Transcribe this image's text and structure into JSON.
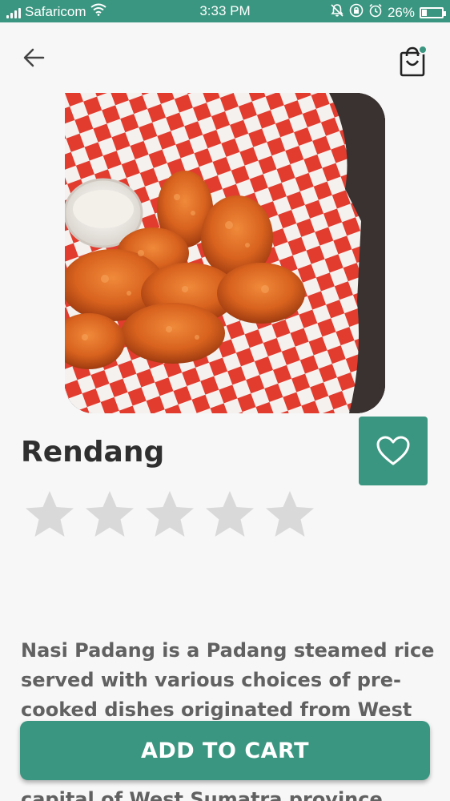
{
  "status_bar": {
    "carrier": "Safaricom",
    "time": "3:33 PM",
    "battery": "26%",
    "battery_level": 0.26,
    "icons": [
      "signal-icon",
      "wifi-icon",
      "mute-icon",
      "lock-rotation-icon",
      "alarm-icon",
      "battery-icon"
    ]
  },
  "header": {
    "back_icon": "arrow-left-icon",
    "cart_icon": "shopping-bag-icon",
    "cart_badge": true
  },
  "product": {
    "name": "Rendang",
    "image": "fried-chicken-basket-photo",
    "rating": {
      "value": 0,
      "max": 5
    },
    "favorite_icon": "heart-outline-icon",
    "description": "Nasi Padang is a Padang steamed rice served with various choices of pre-cooked dishes originated from West Sumatra,",
    "description_tail": "capital of West Sumatra province"
  },
  "actions": {
    "add_to_cart": "ADD TO CART"
  },
  "colors": {
    "accent": "#3a9680",
    "background": "#f7f7f7",
    "star_empty": "#d9d9d9",
    "title": "#2f2f2f",
    "body_text": "#616161"
  }
}
